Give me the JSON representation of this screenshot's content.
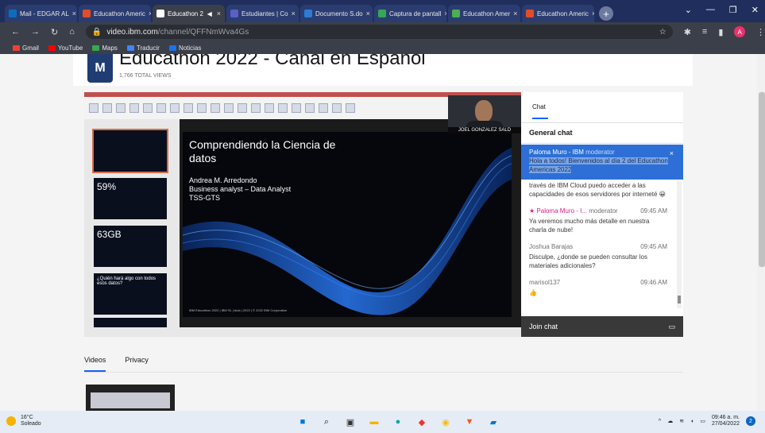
{
  "browser": {
    "tabs": [
      {
        "label": "Mail - EDGAR AL",
        "icon_color": "#0f6cbd"
      },
      {
        "label": "Educathon Americ",
        "icon_color": "#e34c26"
      },
      {
        "label": "Educathon 2",
        "icon_color": "#ffffff",
        "active": true
      },
      {
        "label": "Estudiantes | Co",
        "icon_color": "#5b5fc7"
      },
      {
        "label": "Documento S.do",
        "icon_color": "#2b7cd3"
      },
      {
        "label": "Captura de pantall",
        "icon_color": "#34a853"
      },
      {
        "label": "Educathon Amer",
        "icon_color": "#4caf50"
      },
      {
        "label": "Educathon Americ",
        "icon_color": "#e34c26"
      }
    ],
    "url_domain": "video.ibm.com",
    "url_path": "/channel/QFFNmWva4Gs",
    "bookmarks": [
      {
        "label": "Gmail",
        "color": "#ea4335"
      },
      {
        "label": "YouTube",
        "color": "#ff0000"
      },
      {
        "label": "Maps",
        "color": "#34a853"
      },
      {
        "label": "Traducir",
        "color": "#4285f4"
      },
      {
        "label": "Noticias",
        "color": "#1a73e8"
      }
    ],
    "profile_initial": "A"
  },
  "channel": {
    "title": "Educathon 2022 - Canal en Español",
    "views": "1,766 TOTAL VIEWS",
    "logo_text": "M"
  },
  "slide": {
    "title": "Comprendiendo la Ciencia de datos",
    "presenter": "Andrea M. Arredondo",
    "role": "Business analyst – Data Analyst",
    "org": "TSS-GTS",
    "footer": "IBM Educathon 2022 | IBM SL | Aula | 2022 | © 2022 IBM Corporation"
  },
  "thumbnails": [
    {
      "label": ""
    },
    {
      "label": "59%"
    },
    {
      "label": "63GB"
    },
    {
      "label": "¿Quién hará algo con todos esos datos?"
    },
    {
      "label": ""
    }
  ],
  "webcam": {
    "name": "JOEL GONZALEZ SALD"
  },
  "chat": {
    "tab_label": "Chat",
    "section_title": "General chat",
    "pinned": {
      "author": "Paloma Muro - IBM",
      "role": "moderator",
      "text": "Hola a todos! Bienvenidos al día 2 del Educathon Americas 2022"
    },
    "messages": [
      {
        "author": "",
        "time": "",
        "text": "través de IBM Cloud puedo acceder a las capacidades de esos servidores por interneté 😀"
      },
      {
        "author": "Paloma Muro - I...",
        "role": "moderator",
        "time": "09:45 AM",
        "text": "Ya veremos mucho más detalle en nuestra charla de nube!"
      },
      {
        "author": "Joshua Barajas",
        "role": "",
        "time": "09:45 AM",
        "text": "Disculpe, ¿donde se pueden consultar los materiales adicionales?"
      },
      {
        "author": "marisol137",
        "role": "",
        "time": "09:46 AM",
        "text": "👍"
      }
    ],
    "join_label": "Join chat"
  },
  "page_tabs": {
    "videos": "Videos",
    "privacy": "Privacy"
  },
  "taskbar": {
    "temp": "16°C",
    "weather": "Soleado",
    "time": "09:46 a. m.",
    "date": "27/04/2022"
  }
}
